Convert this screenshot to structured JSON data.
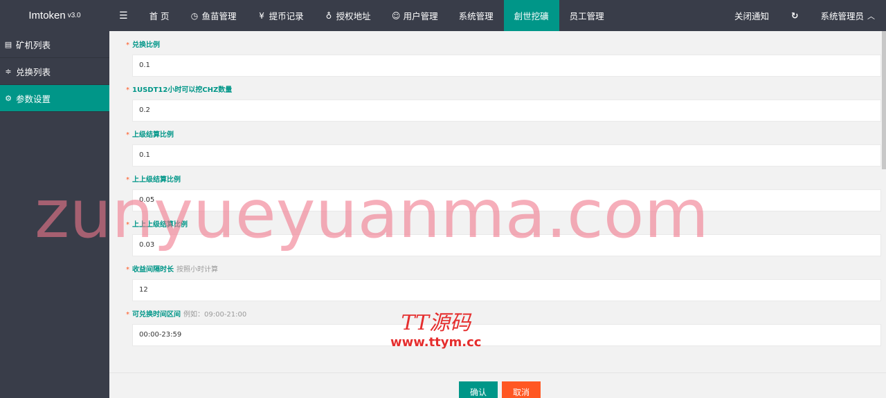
{
  "header": {
    "logo": "Imtoken",
    "version": "v3.0",
    "nav": [
      {
        "label": "首 页",
        "icon": "home"
      },
      {
        "label": "鱼苗管理",
        "icon": "clock"
      },
      {
        "label": "提币记录",
        "icon": "yen"
      },
      {
        "label": "授权地址",
        "icon": "location"
      },
      {
        "label": "用户管理",
        "icon": "user"
      },
      {
        "label": "系统管理",
        "icon": ""
      },
      {
        "label": "創世挖礦",
        "icon": ""
      },
      {
        "label": "员工管理",
        "icon": ""
      }
    ],
    "close_notice": "关闭通知",
    "admin": "系统管理员"
  },
  "sidebar": {
    "items": [
      {
        "label": "矿机列表"
      },
      {
        "label": "兑换列表"
      },
      {
        "label": "参数设置"
      }
    ]
  },
  "form": {
    "fields": [
      {
        "label": "兑换比例",
        "hint": "",
        "value": "0.1"
      },
      {
        "label": "1USDT12小时可以挖CHZ数量",
        "hint": "",
        "value": "0.2"
      },
      {
        "label": "上级结算比例",
        "hint": "",
        "value": "0.1"
      },
      {
        "label": "上上级结算比例",
        "hint": "",
        "value": "0.05"
      },
      {
        "label": "上上上级结算比例",
        "hint": "",
        "value": "0.03"
      },
      {
        "label": "收益间隔时长",
        "hint": "按照小时计算",
        "value": "12"
      },
      {
        "label": "可兑换时间区间",
        "hint": "例如：09:00-21:00",
        "value": "00:00-23:59"
      }
    ],
    "confirm": "确认",
    "cancel": "取消"
  },
  "watermark": {
    "main": "zunyueyuanma.com",
    "logo_line1": "TT源码",
    "logo_line2": "www.ttym.cc"
  },
  "colors": {
    "accent": "#009688",
    "danger": "#ff5722",
    "dark": "#393d49"
  }
}
